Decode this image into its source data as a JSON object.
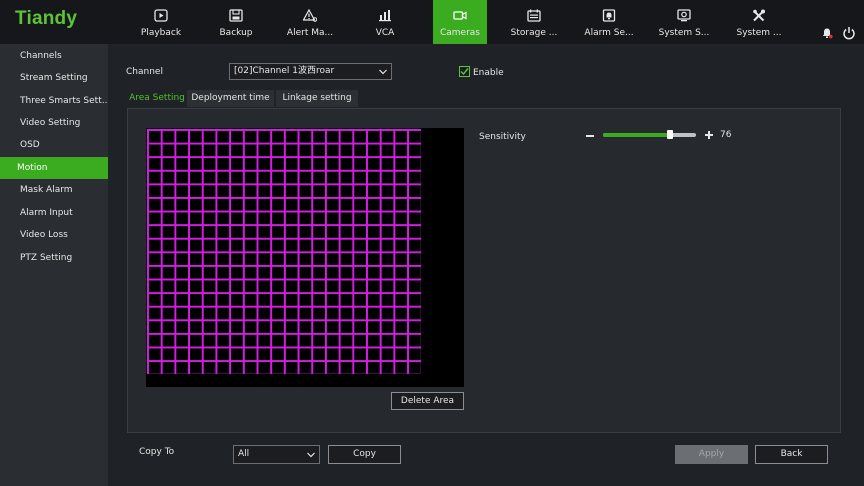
{
  "brand": {
    "logo": "Tiandy",
    "accent_color": "#3bab1f",
    "motion_grid_color": "#d21ee0"
  },
  "nav": [
    {
      "label": "Playback",
      "icon": "playback-icon"
    },
    {
      "label": "Backup",
      "icon": "backup-icon"
    },
    {
      "label": "Alert Ma...",
      "icon": "alert-icon"
    },
    {
      "label": "VCA",
      "icon": "vca-icon"
    },
    {
      "label": "Cameras",
      "icon": "camera-icon",
      "active": true
    },
    {
      "label": "Storage ...",
      "icon": "storage-icon"
    },
    {
      "label": "Alarm Se...",
      "icon": "alarm-icon"
    },
    {
      "label": "System S...",
      "icon": "system-settings-icon"
    },
    {
      "label": "System ...",
      "icon": "system-maintenance-icon"
    }
  ],
  "sidebar": {
    "items": [
      {
        "label": "Channels"
      },
      {
        "label": "Stream Setting"
      },
      {
        "label": "Three Smarts Sett..."
      },
      {
        "label": "Video Setting"
      },
      {
        "label": "OSD"
      },
      {
        "label": "Motion",
        "active": true
      },
      {
        "label": "Mask Alarm"
      },
      {
        "label": "Alarm Input"
      },
      {
        "label": "Video Loss"
      },
      {
        "label": "PTZ Setting"
      }
    ]
  },
  "main": {
    "channel_label": "Channel",
    "channel_value": "[02]Channel 1波西roar",
    "enable_label": "Enable",
    "enable_checked": true,
    "tabs": [
      {
        "label": "Area Setting",
        "active": true
      },
      {
        "label": "Deployment time"
      },
      {
        "label": "Linkage setting"
      }
    ],
    "sensitivity_label": "Sensitivity",
    "sensitivity_value": "76",
    "sensitivity_fraction": 0.72,
    "delete_area_label": "Delete Area",
    "copy_to_label": "Copy To",
    "copy_to_value": "All",
    "copy_label": "Copy",
    "apply_label": "Apply",
    "back_label": "Back"
  }
}
